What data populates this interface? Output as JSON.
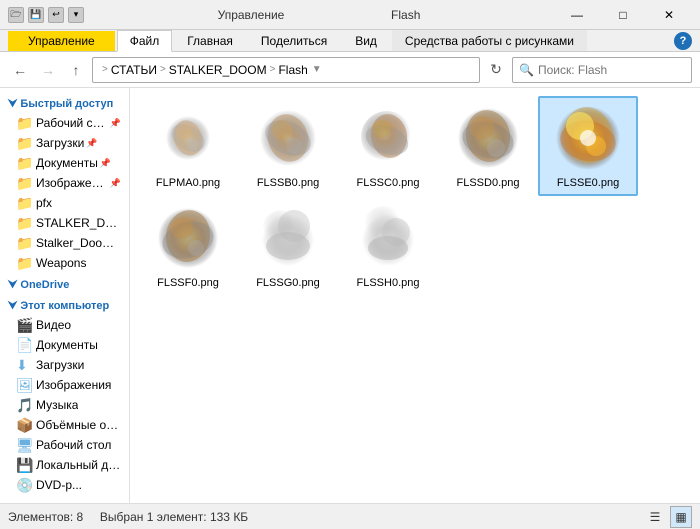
{
  "titleBar": {
    "title": "Управление",
    "appName": "Flash",
    "minimizeLabel": "—",
    "maximizeLabel": "□",
    "closeLabel": "✕"
  },
  "ribbonTabs": [
    {
      "id": "manage",
      "label": "Управление",
      "active": true,
      "highlight": true
    },
    {
      "id": "file",
      "label": "Файл"
    },
    {
      "id": "home",
      "label": "Главная"
    },
    {
      "id": "share",
      "label": "Поделиться"
    },
    {
      "id": "view",
      "label": "Вид"
    },
    {
      "id": "tools",
      "label": "Средства работы с рисунками"
    }
  ],
  "helpLabel": "?",
  "addressBar": {
    "backDisabled": false,
    "forwardDisabled": true,
    "upDisabled": false,
    "pathSegments": [
      "СТАТЬИ",
      "STALKER_DOOM",
      "Flash"
    ],
    "searchPlaceholder": "Поиск: Flash"
  },
  "sidebar": {
    "sections": [
      {
        "id": "quick-access",
        "label": "Быстрый доступ",
        "items": [
          {
            "id": "desktop1",
            "label": "Рабочий сто...",
            "type": "folder",
            "pinned": true
          },
          {
            "id": "downloads1",
            "label": "Загрузки",
            "type": "folder",
            "pinned": true
          },
          {
            "id": "docs1",
            "label": "Документы",
            "type": "folder",
            "pinned": true
          },
          {
            "id": "images1",
            "label": "Изображени...",
            "type": "folder",
            "pinned": true
          }
        ]
      },
      {
        "id": "folders",
        "label": "",
        "items": [
          {
            "id": "pfx",
            "label": "pfx",
            "type": "folder"
          },
          {
            "id": "stalker_doom",
            "label": "STALKER_DOOM",
            "type": "folder"
          },
          {
            "id": "stalker_doom_d",
            "label": "Stalker_Doom_D",
            "type": "folder"
          },
          {
            "id": "weapons",
            "label": "Weapons",
            "type": "folder"
          }
        ]
      },
      {
        "id": "onedrive",
        "label": "OneDrive",
        "items": []
      },
      {
        "id": "this-pc",
        "label": "Этот компьютер",
        "items": [
          {
            "id": "video",
            "label": "Видео",
            "type": "special"
          },
          {
            "id": "docs2",
            "label": "Документы",
            "type": "special"
          },
          {
            "id": "downloads2",
            "label": "Загрузки",
            "type": "special"
          },
          {
            "id": "images2",
            "label": "Изображения",
            "type": "special"
          },
          {
            "id": "music",
            "label": "Музыка",
            "type": "special"
          },
          {
            "id": "volumes",
            "label": "Объёмные объ...",
            "type": "special"
          },
          {
            "id": "desktop2",
            "label": "Рабочий стол",
            "type": "special"
          },
          {
            "id": "local_disk",
            "label": "Локальный дис...",
            "type": "drive"
          },
          {
            "id": "dvd",
            "label": "DVD-р...",
            "type": "drive"
          }
        ]
      }
    ]
  },
  "files": [
    {
      "id": "flpma0",
      "name": "FLPMA0.png",
      "selected": false,
      "explosion": "small"
    },
    {
      "id": "flssb0",
      "name": "FLSSB0.png",
      "selected": false,
      "explosion": "medium"
    },
    {
      "id": "flssc0",
      "name": "FLSSC0.png",
      "selected": false,
      "explosion": "medium"
    },
    {
      "id": "flssd0",
      "name": "FLSSD0.png",
      "selected": false,
      "explosion": "large"
    },
    {
      "id": "flsse0",
      "name": "FLSSE0.png",
      "selected": true,
      "explosion": "large-bright"
    },
    {
      "id": "flssf0",
      "name": "FLSSF0.png",
      "selected": false,
      "explosion": "large"
    },
    {
      "id": "flssg0",
      "name": "FLSSG0.png",
      "selected": false,
      "explosion": "smoke"
    },
    {
      "id": "flssh0",
      "name": "FLSSH0.png",
      "selected": false,
      "explosion": "smoke"
    }
  ],
  "statusBar": {
    "elements": "Элементов: 8",
    "selected": "Выбран 1 элемент: 133 КБ"
  }
}
